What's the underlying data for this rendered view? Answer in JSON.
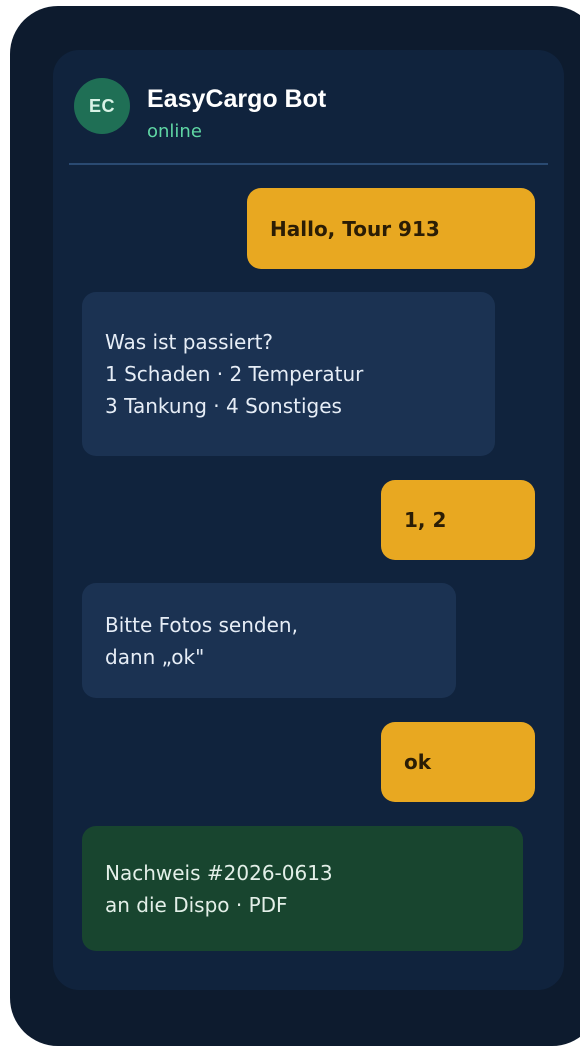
{
  "chat": {
    "avatar_initials": "EC",
    "avatar_color": "#1f6f55",
    "contact_name": "EasyCargo Bot",
    "status": "online",
    "status_color": "#5fd6a4"
  },
  "messages": [
    {
      "direction": "outgoing",
      "lines": [
        "Hallo, Tour 913"
      ]
    },
    {
      "direction": "incoming",
      "lines": [
        "Was ist passiert?",
        "1 Schaden · 2 Temperatur",
        "3 Tankung · 4 Sonstiges"
      ]
    },
    {
      "direction": "outgoing",
      "lines": [
        "1, 2"
      ]
    },
    {
      "direction": "incoming",
      "lines": [
        "Bitte Fotos senden,",
        "dann „ok\""
      ]
    },
    {
      "direction": "outgoing",
      "lines": [
        "ok"
      ]
    },
    {
      "direction": "incoming-confirmation",
      "lines": [
        "Nachweis #2026-0613",
        "an die Dispo · PDF"
      ]
    }
  ],
  "colors": {
    "outgoing_bubble": "#e8a821",
    "incoming_bubble": "#1b3252",
    "confirmation_bubble": "#18452f",
    "background": "#10233d"
  }
}
